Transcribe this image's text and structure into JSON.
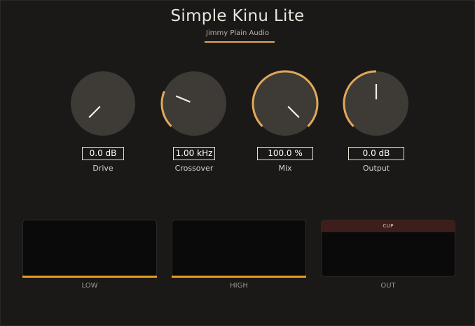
{
  "header": {
    "title": "Simple Kinu Lite",
    "subtitle": "Jimmy Plain Audio"
  },
  "colors": {
    "accent": "#e0a95a",
    "meter_bar": "#e69a20",
    "knob_body": "#3e3a36",
    "background": "#1b1918"
  },
  "knobs": [
    {
      "label": "Drive",
      "value": "0.0 dB",
      "level": 0.0
    },
    {
      "label": "Crossover",
      "value": "1.00 kHz",
      "level": 0.25
    },
    {
      "label": "Mix",
      "value": "100.0 %",
      "level": 1.0
    },
    {
      "label": "Output",
      "value": "0.0 dB",
      "level": 0.5
    }
  ],
  "meters": [
    {
      "label": "LOW"
    },
    {
      "label": "HIGH"
    },
    {
      "label": "OUT",
      "indicator": "CLIP"
    }
  ]
}
